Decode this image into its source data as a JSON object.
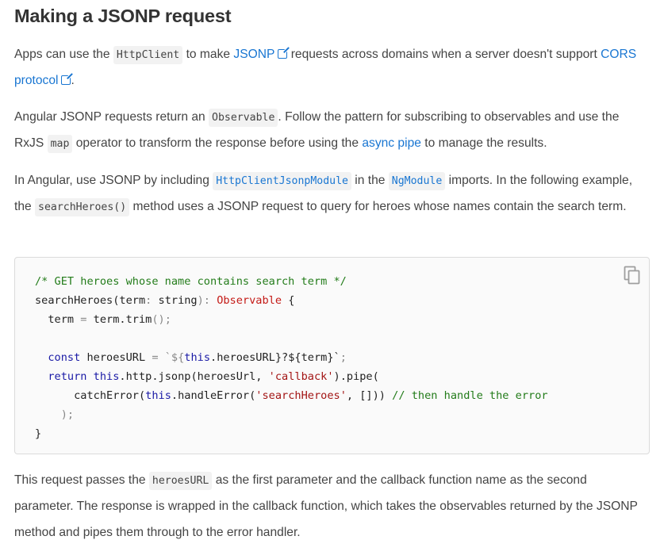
{
  "heading": "Making a JSONP request",
  "p1": {
    "t1": "Apps can use the ",
    "c1": "HttpClient",
    "t2": " to make ",
    "link1": "JSONP",
    "t3": " requests across domains when a server doesn't support ",
    "link2": "CORS protocol",
    "t4": "."
  },
  "p2": {
    "t1": "Angular JSONP requests return an ",
    "c1": "Observable",
    "t2": ". Follow the pattern for subscribing to observables and use the RxJS ",
    "c2": "map",
    "t3": " operator to transform the response before using the ",
    "link1": "async pipe",
    "t4": " to manage the results."
  },
  "p3": {
    "t1": "In Angular, use JSONP by including ",
    "c1": "HttpClientJsonpModule",
    "t2": " in the ",
    "c2": "NgModule",
    "t3": " imports. In the following example, the ",
    "c3": "searchHeroes()",
    "t4": " method uses a JSONP request to query for heroes whose names contain the search term."
  },
  "code": {
    "l1_comment": "/* GET heroes whose name contains search term */",
    "l2_a": "searchHeroes",
    "l2_b": "(term",
    "l2_c": ": ",
    "l2_d": "string",
    "l2_e": "): ",
    "l2_f": "Observable",
    "l2_g": " {",
    "l3_a": "  term ",
    "l3_b": "=",
    "l3_c": " term.trim",
    "l3_d": "();",
    "l5_a": "  ",
    "l5_b": "const",
    "l5_c": " heroesURL ",
    "l5_d": "=",
    "l5_e": " ",
    "l5_f": "`${",
    "l5_g": "this",
    "l5_h": ".heroesURL}?${term}`",
    "l5_i": ";",
    "l6_a": "  ",
    "l6_b": "return",
    "l6_c": " ",
    "l6_d": "this",
    "l6_e": ".http.jsonp(heroesUrl, ",
    "l6_f": "'callback'",
    "l6_g": ").pipe(",
    "l7_a": "      catchError(",
    "l7_b": "this",
    "l7_c": ".handleError(",
    "l7_d": "'searchHeroes'",
    "l7_e": ", [])) ",
    "l7_f": "// then handle the error",
    "l8": "    );",
    "l9": "}"
  },
  "p5": "This request passes the heroesURL as the first parameter and the callback function name as the second parameter. The response is wrapped in the callback function, which takes the observables returned by the JSONP method and pipes them through to the error handler.",
  "p5_parts": {
    "t1": "This request passes the ",
    "c1": "heroesURL",
    "t2": " as the first parameter and the callback function name as the second parameter. The response is wrapped in the callback function, which takes the observables returned by the JSONP method and pipes them through to the error handler."
  },
  "icons": {
    "external": "external-link-icon",
    "copy": "copy-icon"
  },
  "colors": {
    "link": "#1976d2",
    "comment": "#237c1a",
    "keyword": "#1a1aa6",
    "string": "#a31515"
  }
}
